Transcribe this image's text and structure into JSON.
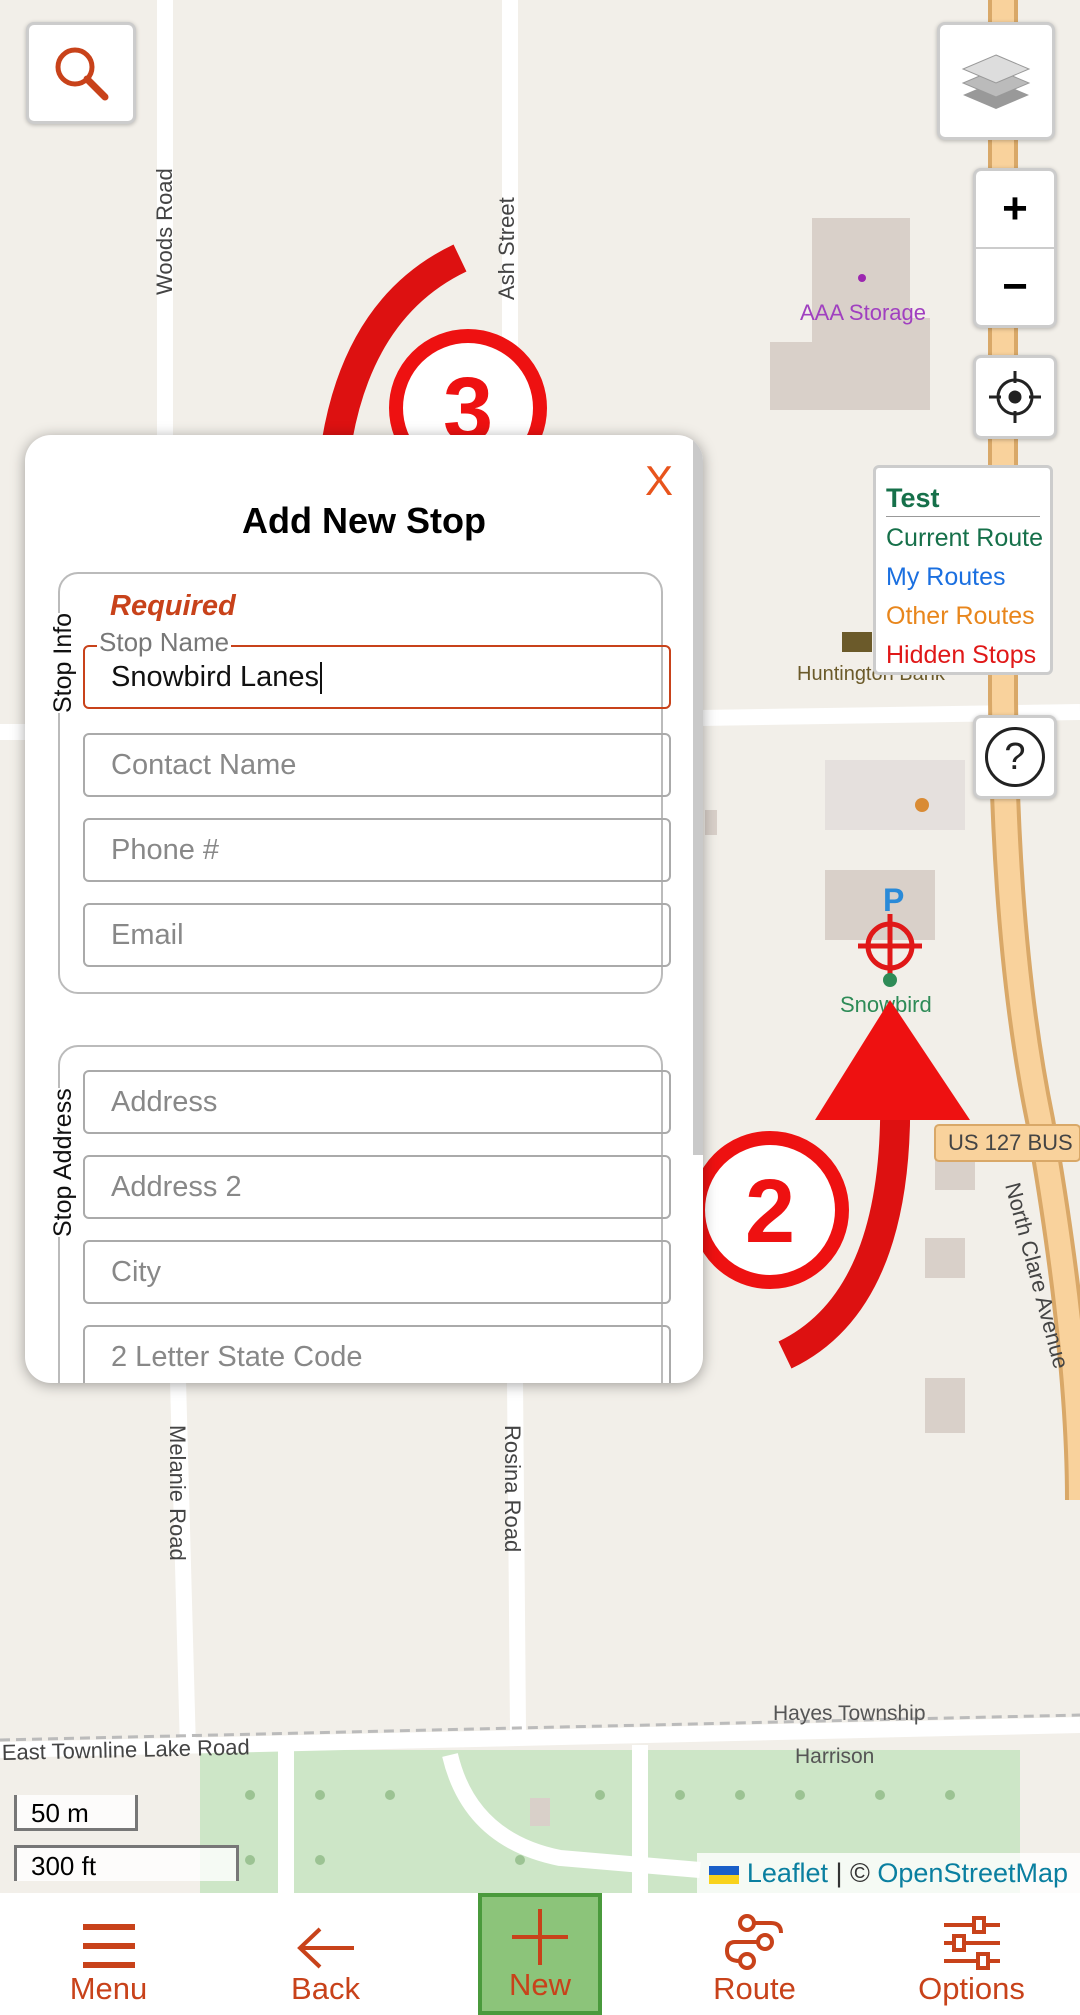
{
  "map": {
    "roads": [
      "Woods Road",
      "Ash Street",
      "Melanie Road",
      "Rosina Road",
      "North Clare Avenue",
      "East Townline Lake Road",
      "US 127 BUS"
    ],
    "places": [
      "AAA Storage",
      "Huntington Bank",
      "Snowbird",
      "Hayes Township",
      "Harrison"
    ],
    "parking_label": "P",
    "callouts": [
      "3",
      "2"
    ]
  },
  "controls": {
    "zoom_in": "+",
    "zoom_out": "−",
    "help": "?"
  },
  "legend": {
    "title": "Test",
    "items": [
      {
        "label": "Current Route",
        "color": "#16704a"
      },
      {
        "label": "My Routes",
        "color": "#1a6fe0"
      },
      {
        "label": "Other Routes",
        "color": "#e8861c"
      },
      {
        "label": "Hidden Stops",
        "color": "#e01818"
      }
    ]
  },
  "scale": {
    "metric": "50 m",
    "imperial": "300 ft"
  },
  "attribution": {
    "leaflet": "Leaflet",
    "separator": " | © ",
    "osm": "OpenStreetMap"
  },
  "dialog": {
    "close": "X",
    "title": "Add New Stop",
    "stop_info": {
      "legend": "Stop Info",
      "required": "Required",
      "stop_name_label": "Stop Name",
      "stop_name_value": "Snowbird Lanes",
      "contact_placeholder": "Contact Name",
      "phone_placeholder": "Phone #",
      "email_placeholder": "Email"
    },
    "stop_address": {
      "legend": "Stop Address",
      "address_placeholder": "Address",
      "address2_placeholder": "Address 2",
      "city_placeholder": "City",
      "state_placeholder": "2 Letter State Code"
    }
  },
  "nav": [
    {
      "label": "Menu"
    },
    {
      "label": "Back"
    },
    {
      "label": "New"
    },
    {
      "label": "Route"
    },
    {
      "label": "Options"
    }
  ],
  "colors": {
    "accent": "#c8421a",
    "callout": "#ee1111",
    "selected_nav": "#8cc47a"
  }
}
